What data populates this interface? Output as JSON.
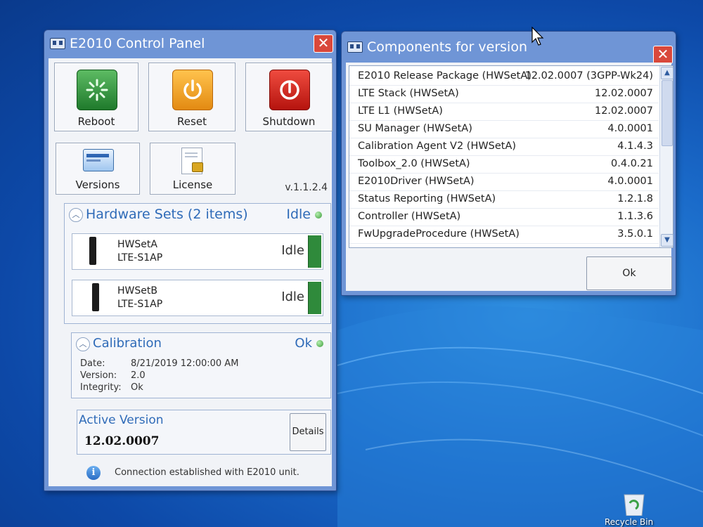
{
  "desktop": {
    "recycle_bin_label": "Recycle Bin"
  },
  "control_panel": {
    "title": "E2010 Control Panel",
    "close_glyph": "✕",
    "buttons": {
      "reboot": "Reboot",
      "reset": "Reset",
      "shutdown": "Shutdown",
      "versions": "Versions",
      "license": "License"
    },
    "version_label": "v.1.1.2.4",
    "hardware_sets": {
      "title": "Hardware Sets (2 items)",
      "status": "Idle",
      "items": [
        {
          "name": "HWSetA",
          "model": "LTE-S1AP",
          "state": "Idle"
        },
        {
          "name": "HWSetB",
          "model": "LTE-S1AP",
          "state": "Idle"
        }
      ]
    },
    "calibration": {
      "title": "Calibration",
      "status": "Ok",
      "date_label": "Date:",
      "date_value": "8/21/2019 12:00:00 AM",
      "version_label": "Version:",
      "version_value": "2.0",
      "integrity_label": "Integrity:",
      "integrity_value": "Ok"
    },
    "active_version": {
      "title": "Active Version",
      "value": "12.02.0007",
      "details_label": "Details"
    },
    "status_message": "Connection established with E2010 unit."
  },
  "components_dialog": {
    "title": "Components for version",
    "close_glyph": "✕",
    "rows": [
      {
        "name": "E2010 Release Package (HWSetA)",
        "version": "12.02.0007 (3GPP-Wk24)"
      },
      {
        "name": "LTE Stack (HWSetA)",
        "version": "12.02.0007"
      },
      {
        "name": "LTE L1 (HWSetA)",
        "version": "12.02.0007"
      },
      {
        "name": "SU Manager (HWSetA)",
        "version": "4.0.0001"
      },
      {
        "name": "Calibration Agent V2 (HWSetA)",
        "version": "4.1.4.3"
      },
      {
        "name": "Toolbox_2.0 (HWSetA)",
        "version": "0.4.0.21"
      },
      {
        "name": "E2010Driver (HWSetA)",
        "version": "4.0.0001"
      },
      {
        "name": "Status Reporting (HWSetA)",
        "version": "1.2.1.8"
      },
      {
        "name": "Controller (HWSetA)",
        "version": "1.1.3.6"
      },
      {
        "name": "FwUpgradeProcedure (HWSetA)",
        "version": "3.5.0.1"
      }
    ],
    "ok_label": "Ok"
  },
  "colors": {
    "desktop": "#1a6ac9",
    "title_bar": "#6f95d6",
    "section_heading": "#2f6bb8",
    "status_green": "#2f8a3b"
  }
}
